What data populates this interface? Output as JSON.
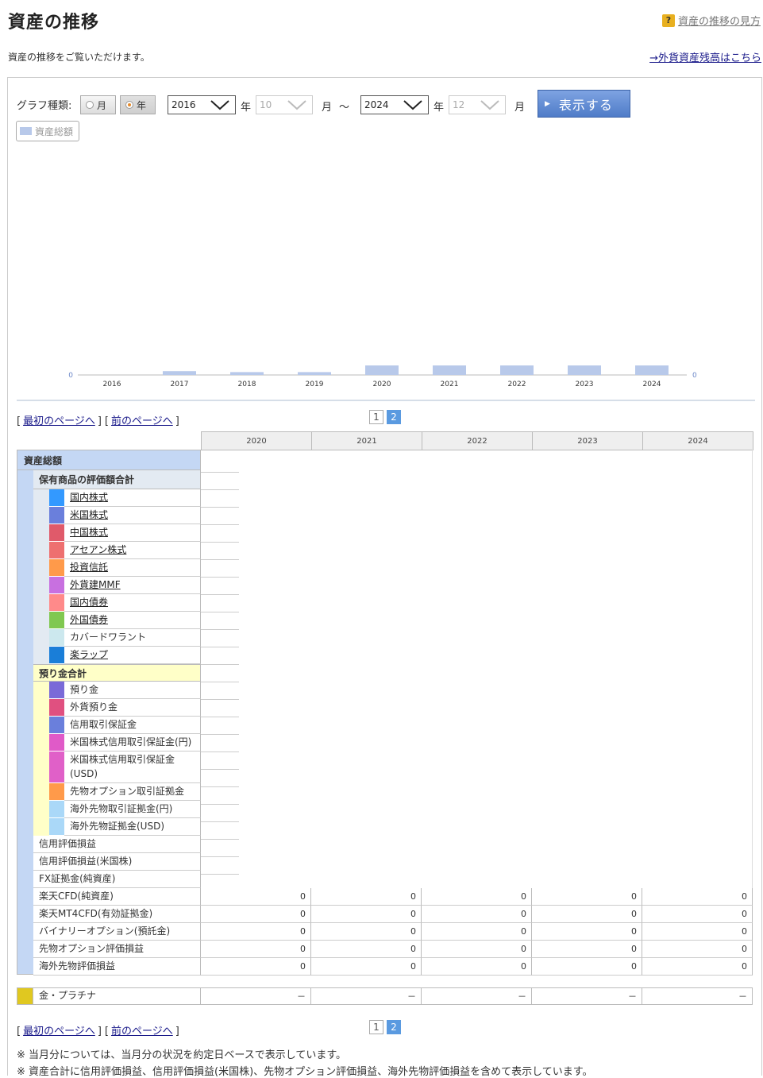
{
  "header": {
    "title": "資産の推移",
    "help_link": "資産の推移の見方",
    "help_icon": "?",
    "subtitle": "資産の推移をご覧いただけます。",
    "fx_link": "→外貨資産残高はこちら"
  },
  "controls": {
    "graph_type_label": "グラフ種類:",
    "radio_month": "月",
    "radio_year": "年",
    "selected": "年",
    "from_year": "2016",
    "from_month": "10",
    "to_year": "2024",
    "to_month": "12",
    "year_unit": "年",
    "month_unit": "月",
    "tilde": "〜",
    "show_button": "表示する"
  },
  "legend": {
    "label": "資産総額",
    "color": "#b8c9ea"
  },
  "chart_data": {
    "type": "bar",
    "categories": [
      "2016",
      "2017",
      "2018",
      "2019",
      "2020",
      "2021",
      "2022",
      "2023",
      "2024"
    ],
    "series": [
      {
        "name": "資産総額",
        "values": [
          0,
          0.4,
          0.3,
          0.3,
          1.0,
          1.0,
          1.0,
          1.0,
          1.0
        ]
      }
    ],
    "left_axis_label": "0",
    "right_axis_label": "0",
    "color": "#b8c9ea"
  },
  "pager": {
    "first": "最初のページへ",
    "prev": "前のページへ",
    "bracket_open": "[",
    "bracket_close": "]",
    "pages": [
      "1",
      "2"
    ],
    "current": "2"
  },
  "table": {
    "years": [
      "2020",
      "2021",
      "2022",
      "2023",
      "2024"
    ],
    "total_label": "資産総額",
    "holdings_label": "保有商品の評価額合計",
    "holdings": [
      {
        "label": "国内株式",
        "color": "#3399ff",
        "link": true
      },
      {
        "label": "米国株式",
        "color": "#6a7fdc",
        "link": true
      },
      {
        "label": "中国株式",
        "color": "#e05a6a",
        "link": true
      },
      {
        "label": "アセアン株式",
        "color": "#ee7070",
        "link": true
      },
      {
        "label": "投資信託",
        "color": "#ff9a4a",
        "link": true
      },
      {
        "label": "外貨建MMF",
        "color": "#c870e0",
        "link": true
      },
      {
        "label": "国内債券",
        "color": "#ff8a8a",
        "link": true
      },
      {
        "label": "外国債券",
        "color": "#80c850",
        "link": true
      },
      {
        "label": "カバードワラント",
        "color": "#cce8ee",
        "link": false
      },
      {
        "label": "楽ラップ",
        "color": "#1a7ed8",
        "link": true
      }
    ],
    "deposits_label": "預り金合計",
    "deposits": [
      {
        "label": "預り金",
        "color": "#7a6ad8"
      },
      {
        "label": "外貨預り金",
        "color": "#e05080"
      },
      {
        "label": "信用取引保証金",
        "color": "#6a7fdc"
      },
      {
        "label": "米国株式信用取引保証金(円)",
        "color": "#e05ac8"
      },
      {
        "label": "米国株式信用取引保証金",
        "label2": "(USD)",
        "color": "#e060c8"
      },
      {
        "label": "先物オプション取引証拠金",
        "color": "#ff9a4a"
      },
      {
        "label": "海外先物取引証拠金(円)",
        "color": "#aad8f8"
      },
      {
        "label": "海外先物証拠金(USD)",
        "color": "#aad8f8"
      }
    ],
    "others": [
      "信用評価損益",
      "信用評価損益(米国株)",
      "FX証拠金(純資産)",
      "楽天CFD(純資産)",
      "楽天MT4CFD(有効証拠金)",
      "バイナリーオプション(預託金)",
      "先物オプション評価損益",
      "海外先物評価損益"
    ],
    "zero": "0",
    "gold_label": "金・プラチナ",
    "gold_color": "#e0c820",
    "dash": "－"
  },
  "notes": [
    "※ 当月分については、当月分の状況を約定日ベースで表示しています。",
    "※ 資産合計に信用評価損益、信用評価損益(米国株)、先物オプション評価損益、海外先物評価損益を含めて表示しています。"
  ]
}
